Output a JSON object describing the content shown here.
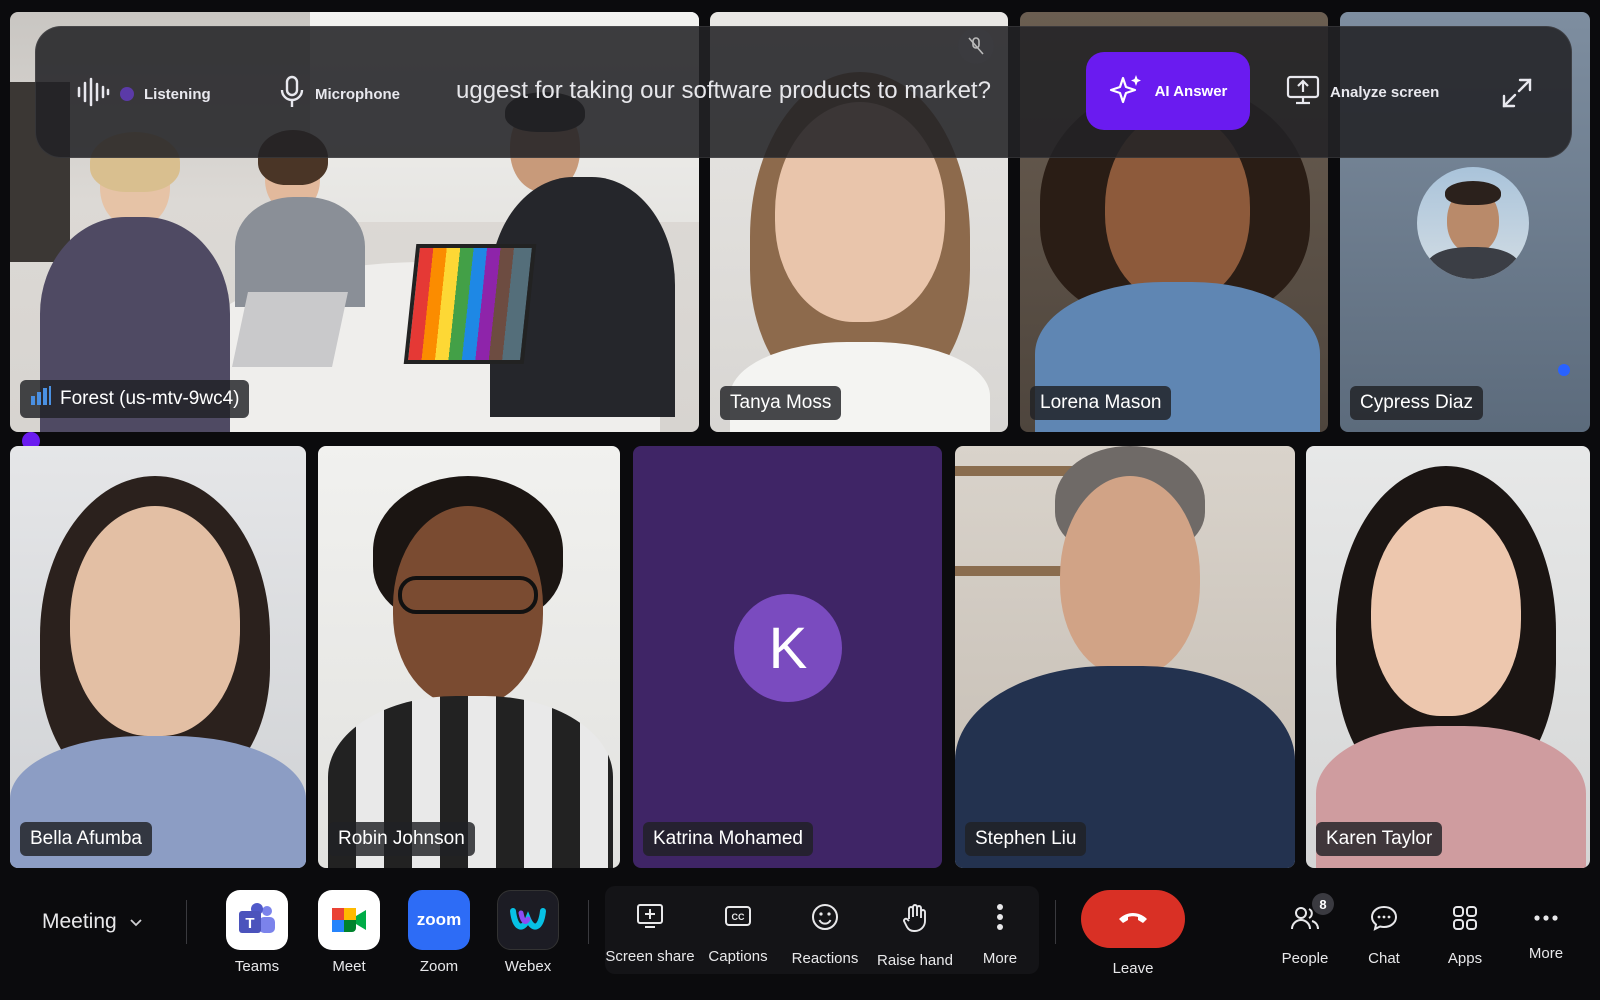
{
  "ai_bar": {
    "listening_label": "Listening",
    "microphone_label": "Microphone",
    "transcript": "uggest for taking our software products to market?",
    "ai_answer_label": "AI Answer",
    "analyze_label": "Analyze screen"
  },
  "participants": {
    "room": "Forest (us-mtv-9wc4)",
    "p1": "Tanya Moss",
    "p2": "Lorena Mason",
    "p3": "Cypress Diaz",
    "p4": "Bella Afumba",
    "p5": "Robin Johnson",
    "p6": "Katrina Mohamed",
    "p6_initial": "K",
    "p7": "Stephen Liu",
    "p8": "Karen Taylor"
  },
  "toolbar": {
    "meeting_label": "Meeting",
    "apps": [
      {
        "label": "Teams"
      },
      {
        "label": "Meet"
      },
      {
        "label": "Zoom",
        "icon_text": "zoom"
      },
      {
        "label": "Webex"
      }
    ],
    "screen_share": "Screen share",
    "captions": "Captions",
    "reactions": "Reactions",
    "raise_hand": "Raise hand",
    "more": "More",
    "leave": "Leave",
    "people": "People",
    "people_count": "8",
    "chat": "Chat",
    "apps_label": "Apps",
    "more_right": "More"
  },
  "colors": {
    "accent_purple": "#6a1bf0",
    "leave_red": "#d93025",
    "tile_purple": "#3f2566",
    "avatar_purple": "#7a4bbf"
  }
}
